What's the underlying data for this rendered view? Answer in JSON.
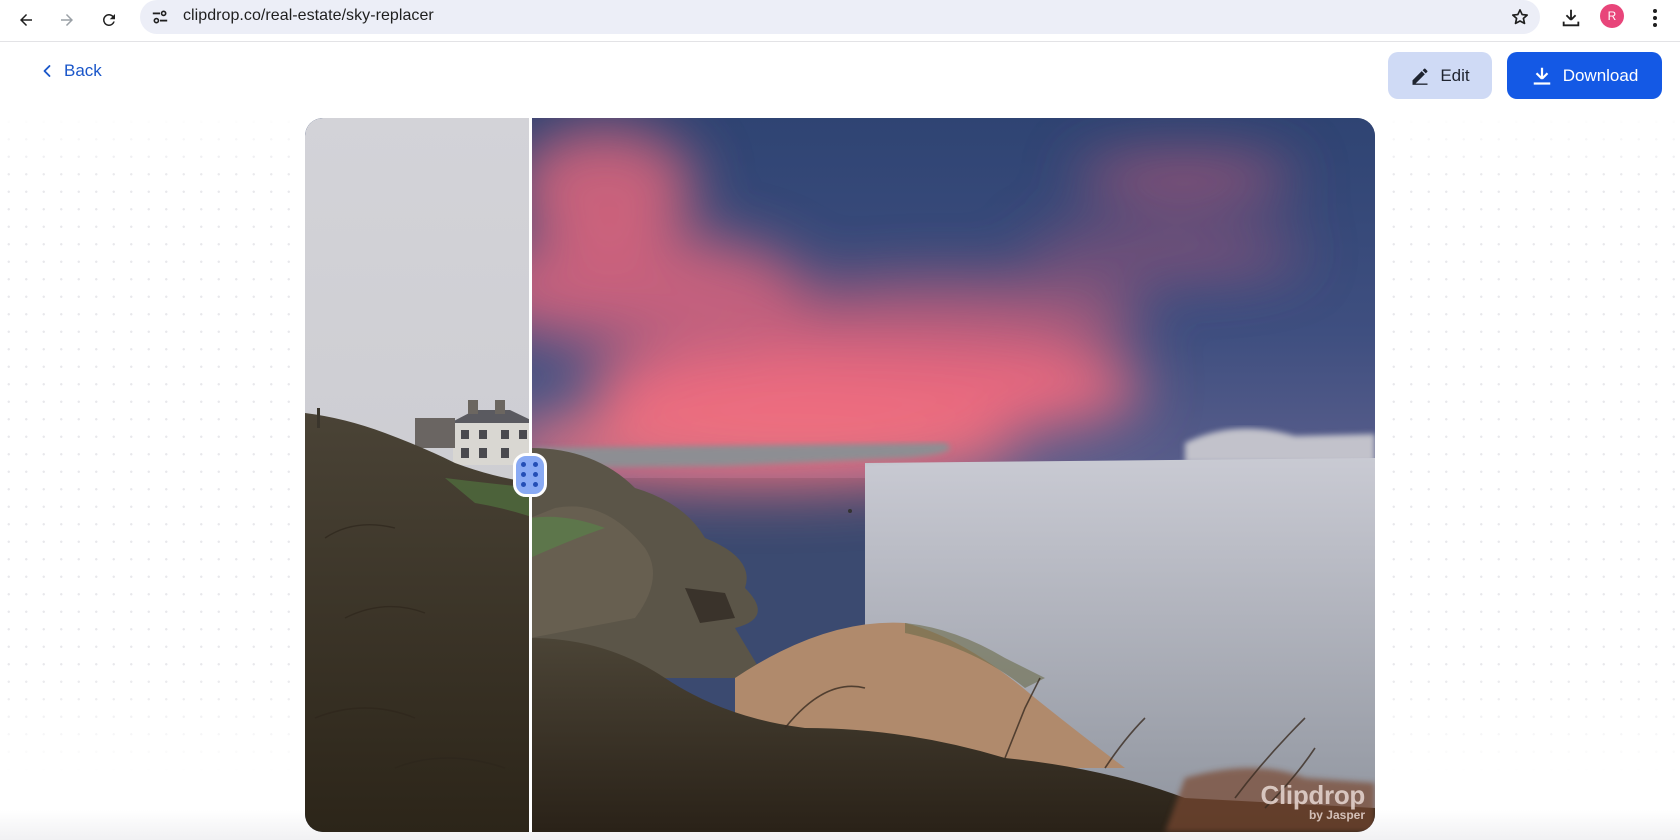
{
  "browser": {
    "url": "clipdrop.co/real-estate/sky-replacer",
    "profile_initial": "R",
    "icons": {
      "back": "arrow-left-icon",
      "forward": "arrow-right-icon",
      "reload": "reload-icon",
      "site_info": "tune-icon",
      "bookmark": "star-outline-icon",
      "downloads": "download-icon",
      "menu": "kebab-menu-icon"
    }
  },
  "header": {
    "back_label": "Back",
    "edit_label": "Edit",
    "download_label": "Download",
    "icons": {
      "back": "chevron-left-icon",
      "edit": "pencil-icon",
      "download": "download-icon"
    }
  },
  "viewer": {
    "type": "before-after-comparison",
    "before_description": "original photo with overcast grey sky",
    "after_description": "sky replaced with dusk sky with pink clouds",
    "slider_position_percent": 21,
    "handle_icon": "drag-handle-dots-icon",
    "watermark": {
      "brand": "Clipdrop",
      "sub": "by Jasper"
    }
  },
  "colors": {
    "accent": "#1459e5",
    "edit_button_bg": "#cfdaf5",
    "link": "#1a56c9",
    "avatar": "#e8457a",
    "handle": "#89aaf4"
  }
}
